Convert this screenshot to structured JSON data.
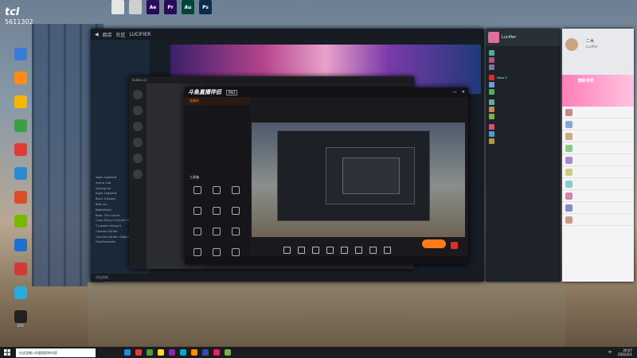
{
  "stream_overlay": {
    "title": "tcI",
    "viewers": "5611302"
  },
  "top_files": [
    {
      "label": "",
      "icon": "document-icon",
      "color": "#e5e5e5"
    },
    {
      "label": "",
      "icon": "document-icon",
      "color": "#cfcfcf"
    },
    {
      "label": "Ae",
      "icon": "after-effects-icon",
      "color": "#2a0a5a"
    },
    {
      "label": "Pr",
      "icon": "premiere-icon",
      "color": "#2a0a5a"
    },
    {
      "label": "Au",
      "icon": "audition-icon",
      "color": "#00443a"
    },
    {
      "label": "Ps",
      "icon": "photoshop-icon",
      "color": "#0c2b4a"
    }
  ],
  "desktop_icons": [
    {
      "label": "",
      "color": "#3a7bd5"
    },
    {
      "label": "",
      "color": "#ff8c1a"
    },
    {
      "label": "",
      "color": "#f2b705"
    },
    {
      "label": "",
      "color": "#3d9f45"
    },
    {
      "label": "",
      "color": "#e03a3a"
    },
    {
      "label": "",
      "color": "#2b8bd0"
    },
    {
      "label": "",
      "color": "#d94d2b"
    },
    {
      "label": "",
      "color": "#76b900"
    },
    {
      "label": "",
      "color": "#1f6fd1"
    },
    {
      "label": "",
      "color": "#d23a3a"
    },
    {
      "label": "",
      "color": "#29aae1"
    },
    {
      "label": "EPIC",
      "color": "#222222"
    }
  ],
  "steam": {
    "nav": [
      "商店",
      "社区",
      "LUCIFIER"
    ],
    "sidebar_items": [
      "",
      "",
      "",
      "",
      "",
      "",
      "",
      "",
      "",
      "",
      "",
      "",
      "",
      "",
      "",
      "",
      "",
      "",
      "",
      "",
      "",
      "",
      "",
      "",
      "",
      "Apex Legends",
      "Arena Lab",
      "Among Us",
      "Apex Legends",
      "Back 4 Blood",
      "Bad Ink",
      "Battlefield",
      "Bloo: The Game",
      "Cave Story's Secret Santa",
      "Crusader Kings II",
      "Counter-Strike",
      "Counter-Strike: Global Offensive",
      "Gearhorpade"
    ],
    "footer": "添加游戏"
  },
  "launcher": {
    "title": "kukalu.cc"
  },
  "obs": {
    "logo": "斗鱼直播伴侣",
    "badge": "PRO",
    "left_items": [
      {
        "label": "直播间",
        "active": true
      },
      {
        "label": "",
        "active": false
      },
      {
        "label": "",
        "active": false
      },
      {
        "label": "",
        "active": false
      },
      {
        "label": "",
        "active": false
      },
      {
        "label": "",
        "active": false
      },
      {
        "label": "",
        "active": false
      },
      {
        "label": "",
        "active": false
      }
    ],
    "tools_title": "工具箱",
    "tools": [
      "",
      "",
      "",
      "",
      "",
      "",
      "",
      "",
      "",
      "",
      "",
      ""
    ],
    "controls": [
      "",
      "",
      "",
      "",
      "",
      "",
      "",
      ""
    ],
    "start_label": "",
    "footer_text": ""
  },
  "friends": {
    "user": "Lucifier",
    "sections": [
      "",
      "",
      "",
      "",
      ""
    ],
    "rows": [
      {
        "name": "",
        "color": "#5a9"
      },
      {
        "name": "",
        "color": "#a57"
      },
      {
        "name": "",
        "color": "#779"
      },
      {
        "name": "Dota 2",
        "color": "#c33"
      },
      {
        "name": "",
        "color": "#79c"
      },
      {
        "name": "",
        "color": "#5a6"
      },
      {
        "name": "",
        "color": "#6a9"
      },
      {
        "name": "",
        "color": "#b86"
      },
      {
        "name": "",
        "color": "#8a5"
      },
      {
        "name": "",
        "color": "#c57"
      },
      {
        "name": "",
        "color": "#59c"
      },
      {
        "name": "",
        "color": "#a94"
      }
    ]
  },
  "chat": {
    "name": "二木",
    "sub": "Lucifier",
    "banner": "精彩世界",
    "rows": [
      {
        "name": "",
        "color": "#c88"
      },
      {
        "name": "",
        "color": "#8ac"
      },
      {
        "name": "",
        "color": "#ca8"
      },
      {
        "name": "",
        "color": "#8c8"
      },
      {
        "name": "",
        "color": "#a8c"
      },
      {
        "name": "",
        "color": "#cc8"
      },
      {
        "name": "",
        "color": "#8cc"
      },
      {
        "name": "",
        "color": "#c8a"
      },
      {
        "name": "",
        "color": "#88c"
      },
      {
        "name": "",
        "color": "#c98"
      }
    ]
  },
  "taskbar": {
    "search_placeholder": "在这里输入你要搜索的内容",
    "apps": [
      "#1e88e5",
      "#e53935",
      "#43a047",
      "#fdd835",
      "#8e24aa",
      "#00acc1",
      "#fb8c00",
      "#3949ab",
      "#e91e63",
      "#7cb342"
    ],
    "lang": "中",
    "time": "20:07",
    "date": "2022/2/1"
  }
}
